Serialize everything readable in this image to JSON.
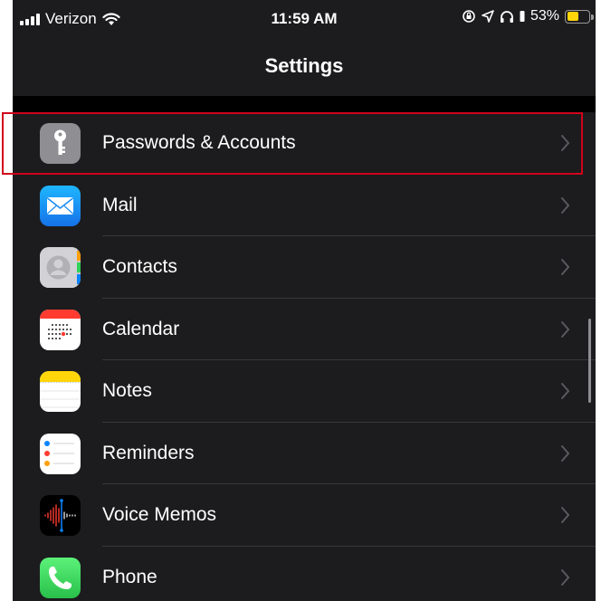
{
  "status_bar": {
    "carrier": "Verizon",
    "time": "11:59 AM",
    "battery": "53%",
    "battery_level": 0.53,
    "icons": [
      "signal-icon",
      "wifi-icon",
      "orientation-lock-icon",
      "location-icon",
      "headphones-icon",
      "battery-icon"
    ]
  },
  "nav": {
    "title": "Settings"
  },
  "rows": [
    {
      "label": "Passwords & Accounts",
      "icon": "key-icon",
      "color": "#8e8e93",
      "highlighted": true
    },
    {
      "label": "Mail",
      "icon": "envelope-icon",
      "color": "#1a8cf0"
    },
    {
      "label": "Contacts",
      "icon": "contacts-icon",
      "color": "#c6c6c8"
    },
    {
      "label": "Calendar",
      "icon": "calendar-icon",
      "color": "#ffffff"
    },
    {
      "label": "Notes",
      "icon": "notes-icon",
      "color": "#ffd60a"
    },
    {
      "label": "Reminders",
      "icon": "reminders-icon",
      "color": "#ffffff"
    },
    {
      "label": "Voice Memos",
      "icon": "waveform-icon",
      "color": "#000000"
    },
    {
      "label": "Phone",
      "icon": "phone-icon",
      "color": "#32c95a"
    }
  ],
  "colors": {
    "highlight": "#d0021b",
    "background": "#1c1c1e"
  }
}
